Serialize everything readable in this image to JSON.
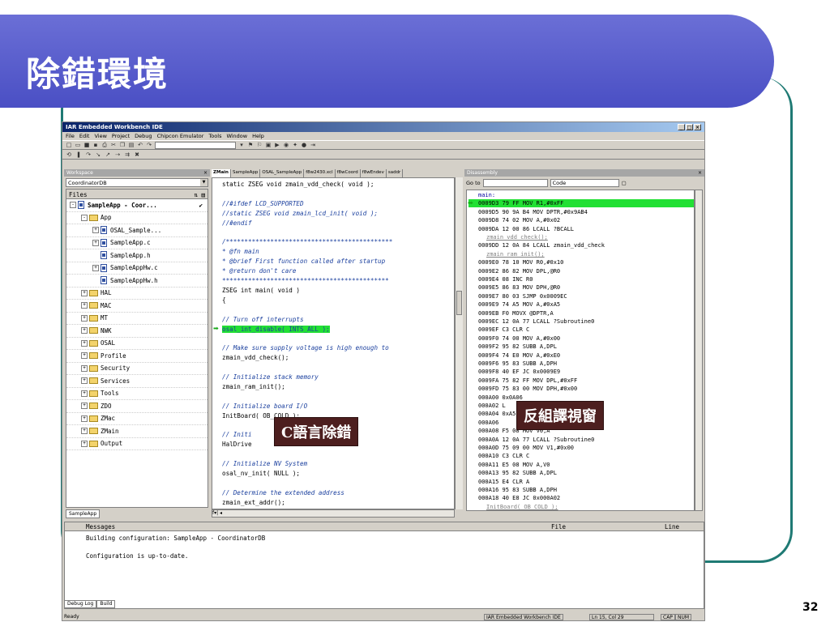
{
  "slide": {
    "title": "除錯環境",
    "page_number": "32",
    "accent": "#5a5ecf"
  },
  "ide": {
    "window_title": "IAR Embedded Workbench IDE",
    "menu": [
      "File",
      "Edit",
      "View",
      "Project",
      "Debug",
      "Chipcon Emulator",
      "Tools",
      "Window",
      "Help"
    ],
    "workspace": {
      "pane_label": "Workspace",
      "config": "CoordinatorDB",
      "files_header": "Files",
      "tab": "SampleApp",
      "tree": [
        {
          "label": "SampleApp - Coor...",
          "indent": 0,
          "kind": "project",
          "exp": "-",
          "check": "✔"
        },
        {
          "label": "App",
          "indent": 1,
          "kind": "folder",
          "exp": "-"
        },
        {
          "label": "OSAL_Sample...",
          "indent": 2,
          "kind": "file",
          "exp": "+"
        },
        {
          "label": "SampleApp.c",
          "indent": 2,
          "kind": "file",
          "exp": "+"
        },
        {
          "label": "SampleApp.h",
          "indent": 2,
          "kind": "file",
          "exp": ""
        },
        {
          "label": "SampleAppHw.c",
          "indent": 2,
          "kind": "file",
          "exp": "+"
        },
        {
          "label": "SampleAppHw.h",
          "indent": 2,
          "kind": "file",
          "exp": ""
        },
        {
          "label": "HAL",
          "indent": 1,
          "kind": "folder",
          "exp": "+"
        },
        {
          "label": "MAC",
          "indent": 1,
          "kind": "folder",
          "exp": "+"
        },
        {
          "label": "MT",
          "indent": 1,
          "kind": "folder",
          "exp": "+"
        },
        {
          "label": "NWK",
          "indent": 1,
          "kind": "folder",
          "exp": "+"
        },
        {
          "label": "OSAL",
          "indent": 1,
          "kind": "folder",
          "exp": "+"
        },
        {
          "label": "Profile",
          "indent": 1,
          "kind": "folder",
          "exp": "+"
        },
        {
          "label": "Security",
          "indent": 1,
          "kind": "folder",
          "exp": "+"
        },
        {
          "label": "Services",
          "indent": 1,
          "kind": "folder",
          "exp": "+"
        },
        {
          "label": "Tools",
          "indent": 1,
          "kind": "folder",
          "exp": "+"
        },
        {
          "label": "ZDO",
          "indent": 1,
          "kind": "folder",
          "exp": "+"
        },
        {
          "label": "ZMac",
          "indent": 1,
          "kind": "folder",
          "exp": "+"
        },
        {
          "label": "ZMain",
          "indent": 1,
          "kind": "folder",
          "exp": "+"
        },
        {
          "label": "Output",
          "indent": 1,
          "kind": "folder",
          "exp": "+"
        }
      ]
    },
    "editor": {
      "tabs": [
        "ZMain",
        "SampleApp",
        "OSAL_SampleApp",
        "f8w2430.xcl",
        "f8wCoord",
        "f8wEndev",
        "saddr"
      ],
      "lines": [
        {
          "t": "static ZSEG void zmain_vdd_check( void );",
          "c": "kw"
        },
        {
          "t": "",
          "c": "kw"
        },
        {
          "t": "//#ifdef LCD_SUPPORTED",
          "c": "cm"
        },
        {
          "t": "//static ZSEG void zmain_lcd_init( void );",
          "c": "cm"
        },
        {
          "t": "//#endif",
          "c": "cm"
        },
        {
          "t": "",
          "c": "kw"
        },
        {
          "t": "/*********************************************",
          "c": "cm"
        },
        {
          "t": " * @fn      main",
          "c": "cm"
        },
        {
          "t": " * @brief   First function called after startup",
          "c": "cm"
        },
        {
          "t": " * @return  don't care",
          "c": "cm"
        },
        {
          "t": " *********************************************",
          "c": "cm"
        },
        {
          "t": "ZSEG int main( void )",
          "c": "kw"
        },
        {
          "t": "{",
          "c": "kw"
        },
        {
          "t": "",
          "c": "kw"
        },
        {
          "t": "  // Turn off interrupts",
          "c": "cm"
        },
        {
          "t": "  osal_int_disable( INTS_ALL );",
          "c": "hl"
        },
        {
          "t": "",
          "c": "kw"
        },
        {
          "t": "  // Make sure supply voltage is high enough to",
          "c": "cm"
        },
        {
          "t": "  zmain_vdd_check();",
          "c": "kw"
        },
        {
          "t": "",
          "c": "kw"
        },
        {
          "t": "  // Initialize stack memory",
          "c": "cm"
        },
        {
          "t": "  zmain_ram_init();",
          "c": "kw"
        },
        {
          "t": "",
          "c": "kw"
        },
        {
          "t": "  // Initialize board I/O",
          "c": "cm"
        },
        {
          "t": "  InitBoard( OB_COLD );",
          "c": "kw"
        },
        {
          "t": "",
          "c": "kw"
        },
        {
          "t": "  // Initi",
          "c": "cm"
        },
        {
          "t": "  HalDrive",
          "c": "kw"
        },
        {
          "t": "",
          "c": "kw"
        },
        {
          "t": "  // Initialize NV System",
          "c": "cm"
        },
        {
          "t": "  osal_nv_init( NULL );",
          "c": "kw"
        },
        {
          "t": "",
          "c": "kw"
        },
        {
          "t": "  // Determine the extended address",
          "c": "cm"
        },
        {
          "t": "  zmain_ext_addr();",
          "c": "kw"
        }
      ]
    },
    "disasm": {
      "pane_label": "Disassembly",
      "goto_label": "Go to",
      "mode": "Code",
      "lines": [
        {
          "t": "main:",
          "k": "lbl"
        },
        {
          "t": "0009D3 79 FF          MOV   R1,#0xFF",
          "k": "hl"
        },
        {
          "t": "0009D5 90 9A B4       MOV   DPTR,#0x9AB4",
          "k": "n"
        },
        {
          "t": "0009D8 74 02          MOV   A,#0x02",
          "k": "n"
        },
        {
          "t": "0009DA 12 00 86       LCALL ?BCALL",
          "k": "n"
        },
        {
          "t": "zmain_vdd_check();",
          "k": "src"
        },
        {
          "t": "0009DD 12 0A 84       LCALL zmain_vdd_check",
          "k": "n"
        },
        {
          "t": "zmain_ram_init();",
          "k": "src"
        },
        {
          "t": "0009E0 78 10          MOV   R0,#0x10",
          "k": "n"
        },
        {
          "t": "0009E2 86 82          MOV   DPL,@R0",
          "k": "n"
        },
        {
          "t": "0009E4 08             INC   R0",
          "k": "n"
        },
        {
          "t": "0009E5 86 83          MOV   DPH,@R0",
          "k": "n"
        },
        {
          "t": "0009E7 80 03          SJMP  0x0009EC",
          "k": "n"
        },
        {
          "t": "0009E9 74 A5          MOV   A,#0xA5",
          "k": "n"
        },
        {
          "t": "0009EB F0             MOVX  @DPTR,A",
          "k": "n"
        },
        {
          "t": "0009EC 12 0A 77       LCALL ?Subroutine0",
          "k": "n"
        },
        {
          "t": "0009EF C3             CLR   C",
          "k": "n"
        },
        {
          "t": "0009F0 74 00          MOV   A,#0x00",
          "k": "n"
        },
        {
          "t": "0009F2 95 82          SUBB  A,DPL",
          "k": "n"
        },
        {
          "t": "0009F4 74 E0          MOV   A,#0xE0",
          "k": "n"
        },
        {
          "t": "0009F6 95 83          SUBB  A,DPH",
          "k": "n"
        },
        {
          "t": "0009F8 40 EF          JC    0x0009E9",
          "k": "n"
        },
        {
          "t": "0009FA 75 82 FF       MOV   DPL,#0xFF",
          "k": "n"
        },
        {
          "t": "0009FD 75 83 00       MOV   DPH,#0x00",
          "k": "n"
        },
        {
          "t": "000A00                      0x0A06",
          "k": "n"
        },
        {
          "t": "000A02                      L",
          "k": "n"
        },
        {
          "t": "000A04                      0xA5",
          "k": "n"
        },
        {
          "t": "000A06",
          "k": "n"
        },
        {
          "t": "000A08 F5 08          MOV   V0,A",
          "k": "n"
        },
        {
          "t": "000A0A 12 0A 77       LCALL ?Subroutine0",
          "k": "n"
        },
        {
          "t": "000A0D 75 09 00       MOV   V1,#0x00",
          "k": "n"
        },
        {
          "t": "000A10 C3             CLR   C",
          "k": "n"
        },
        {
          "t": "000A11 E5 08          MOV   A,V0",
          "k": "n"
        },
        {
          "t": "000A13 95 82          SUBB  A,DPL",
          "k": "n"
        },
        {
          "t": "000A15 E4             CLR   A",
          "k": "n"
        },
        {
          "t": "000A16 95 83          SUBB  A,DPH",
          "k": "n"
        },
        {
          "t": "000A18 40 E8          JC    0x000A02",
          "k": "n"
        },
        {
          "t": "InitBoard( OB_COLD );",
          "k": "src"
        }
      ]
    },
    "messages": {
      "header_messages": "Messages",
      "header_file": "File",
      "header_line": "Line",
      "lines": [
        "Building configuration: SampleApp - CoordinatorDB",
        "",
        "Configuration is up-to-date."
      ],
      "tabs": [
        "Debug Log",
        "Build"
      ]
    },
    "status": {
      "ready": "Ready",
      "app": "IAR Embedded Workbench IDE",
      "position": "Ln 15, Col 29",
      "caps": "CAP",
      "num": "NUM"
    }
  },
  "callouts": {
    "c_debug": "C語言除錯",
    "disasm_view": "反組譯視窗"
  }
}
